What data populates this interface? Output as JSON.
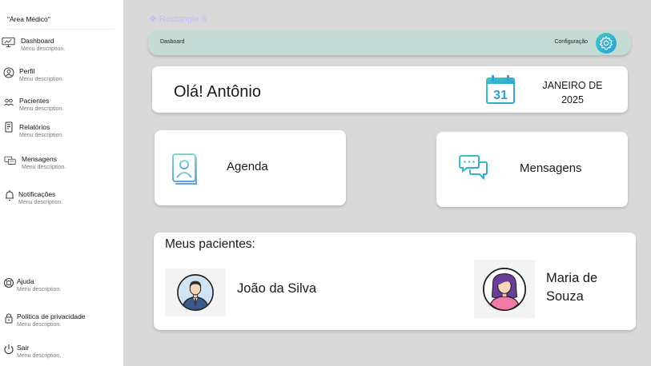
{
  "sidebar": {
    "title": "\"Área Médico\"",
    "items": [
      {
        "label": "Dashboard",
        "desc": "Menu description.",
        "icon": "monitor-icon"
      },
      {
        "label": "Perfil",
        "desc": "Menu description.",
        "icon": "user-circle-icon"
      },
      {
        "label": "Pacientes",
        "desc": "Menu description.",
        "icon": "group-icon"
      },
      {
        "label": "Relatórios",
        "desc": "Menu description.",
        "icon": "report-icon"
      },
      {
        "label": "Mensagens",
        "desc": "Menu description.",
        "icon": "messages-icon"
      },
      {
        "label": "Notificações",
        "desc": "Menu description.",
        "icon": "bell-icon"
      }
    ],
    "bottom_items": [
      {
        "label": "Ajuda",
        "desc": "Menu description.",
        "icon": "help-icon"
      },
      {
        "label": "Política de privacidade",
        "desc": "Menu description.",
        "icon": "lock-icon"
      },
      {
        "label": "Sair",
        "desc": "Menu description.",
        "icon": "power-icon"
      }
    ]
  },
  "frame_tag": "❖ Rectangle 6",
  "topbar": {
    "left_label": "Dasboard",
    "right_label": "Configuração",
    "gear_icon": "gear-icon"
  },
  "greeting": {
    "text": "Olá! Antônio",
    "calendar_day": "31",
    "month_line1": "JANEIRO DE",
    "month_line2": "2025"
  },
  "cards": {
    "agenda": "Agenda",
    "mensagens": "Mensagens"
  },
  "patients": {
    "title": "Meus pacientes:",
    "list": [
      {
        "name": "João da Silva"
      },
      {
        "name_line1": "Maria de",
        "name_line2": "Souza"
      }
    ]
  },
  "colors": {
    "background": "#d9d9d9",
    "topbar": "#c5dbd6",
    "accent_teal": "#3ec9c0",
    "accent_blue": "#2c9fd9"
  }
}
